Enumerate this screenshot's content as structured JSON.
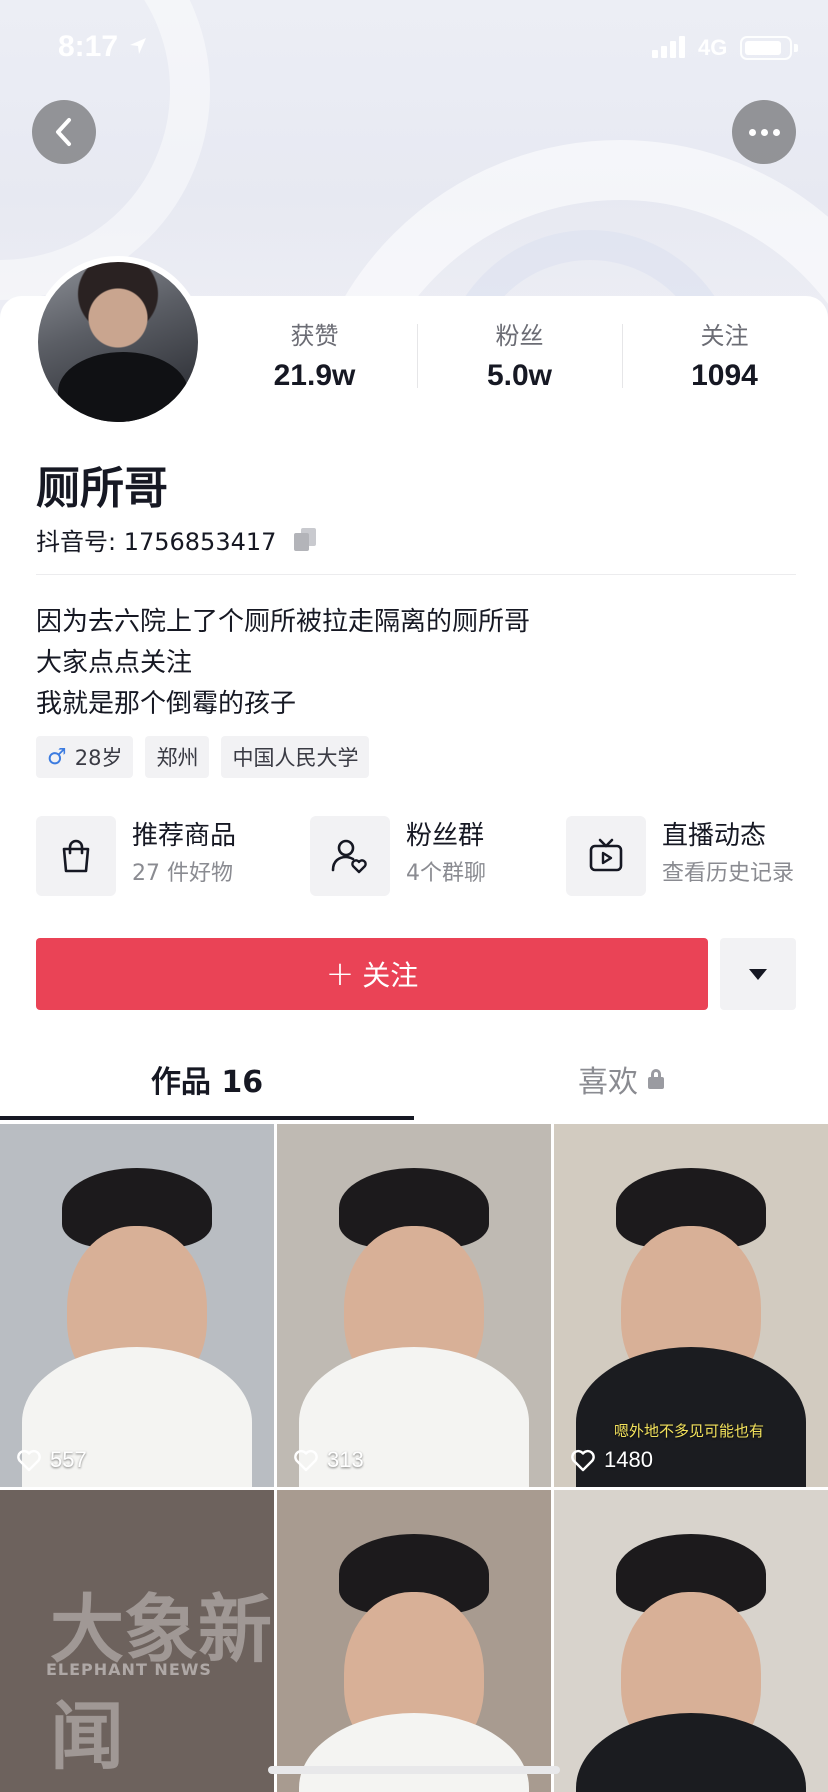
{
  "status_bar": {
    "time": "8:17",
    "network": "4G",
    "battery_level": 0.85,
    "signal_bars": 4
  },
  "profile": {
    "stats": [
      {
        "label": "获赞",
        "value": "21.9w"
      },
      {
        "label": "粉丝",
        "value": "5.0w"
      },
      {
        "label": "关注",
        "value": "1094"
      }
    ],
    "name": "厕所哥",
    "id_label": "抖音号: 1756853417",
    "bio_lines": [
      "因为去六院上了个厕所被拉走隔离的厕所哥",
      "大家点点关注",
      "我就是那个倒霉的孩子"
    ],
    "tags": {
      "age": "28岁",
      "city": "郑州",
      "school": "中国人民大学"
    }
  },
  "features": [
    {
      "icon": "shopping-bag-icon",
      "title": "推荐商品",
      "subtitle": "27 件好物"
    },
    {
      "icon": "fan-group-icon",
      "title": "粉丝群",
      "subtitle": "4个群聊"
    },
    {
      "icon": "live-replay-icon",
      "title": "直播动态",
      "subtitle": "查看历史记录"
    }
  ],
  "actions": {
    "follow_label": "关注"
  },
  "tabs": {
    "works": "作品 16",
    "likes": "喜欢"
  },
  "videos": [
    {
      "likes": "557",
      "shirt": "white",
      "bg": "#b9bdc2"
    },
    {
      "likes": "313",
      "shirt": "white",
      "bg": "#bfbab3"
    },
    {
      "likes": "1480",
      "shirt": "black",
      "bg": "#d2cbc0",
      "caption": "嗯外地不多见可能也有"
    },
    {
      "likes": "",
      "watermark": "大象新闻",
      "watermark_sub": "ELEPHANT NEWS",
      "bg": "#6d625d"
    },
    {
      "likes": "",
      "shirt": "white",
      "bg": "#a89b90"
    },
    {
      "likes": "",
      "shirt": "black",
      "bg": "#d8d3cc"
    }
  ]
}
